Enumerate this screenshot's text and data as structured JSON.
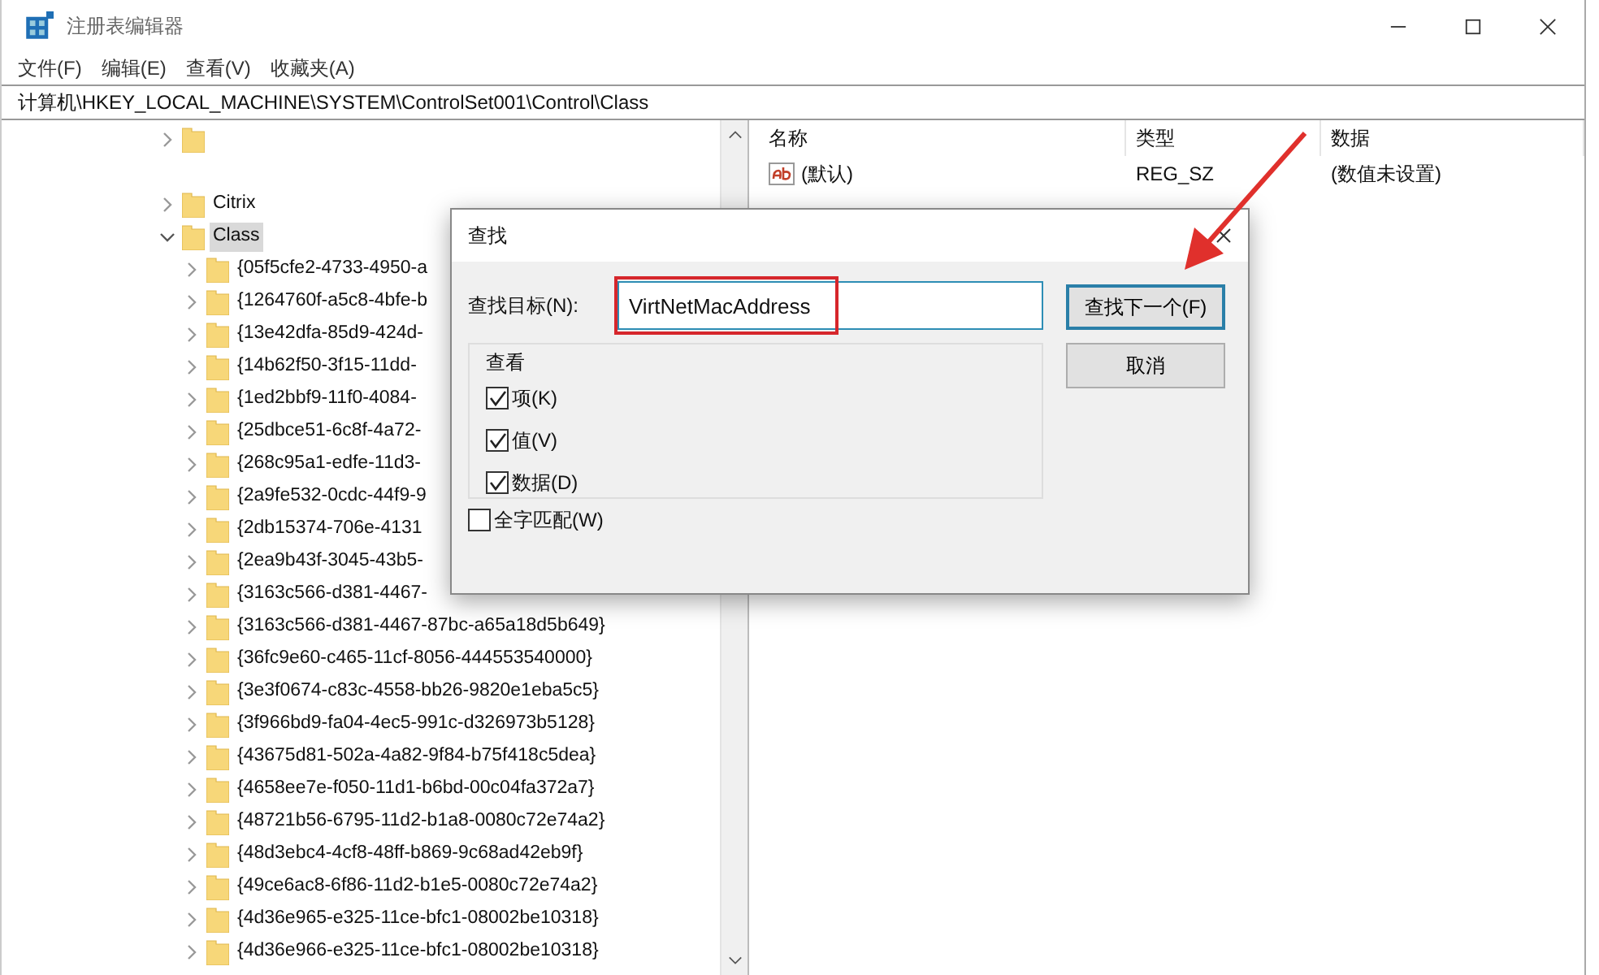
{
  "window": {
    "title": "注册表编辑器"
  },
  "menu": [
    "文件(F)",
    "编辑(E)",
    "查看(V)",
    "收藏夹(A)"
  ],
  "address": "计算机\\HKEY_LOCAL_MACHINE\\SYSTEM\\ControlSet001\\Control\\Class",
  "tree": [
    {
      "kind": "obscured",
      "expanded": false
    },
    {
      "kind": "blank"
    },
    {
      "kind": "folder",
      "label": "Citrix",
      "expanded": false,
      "selected": false
    },
    {
      "kind": "folder",
      "label": "Class",
      "expanded": true,
      "selected": true,
      "children": [
        {
          "label": "{05f5cfe2-4733-4950-a"
        },
        {
          "label": "{1264760f-a5c8-4bfe-b"
        },
        {
          "label": "{13e42dfa-85d9-424d-"
        },
        {
          "label": "{14b62f50-3f15-11dd-"
        },
        {
          "label": "{1ed2bbf9-11f0-4084-"
        },
        {
          "label": "{25dbce51-6c8f-4a72-"
        },
        {
          "label": "{268c95a1-edfe-11d3-"
        },
        {
          "label": "{2a9fe532-0cdc-44f9-9"
        },
        {
          "label": "{2db15374-706e-4131"
        },
        {
          "label": "{2ea9b43f-3045-43b5-"
        },
        {
          "label": "{3163c566-d381-4467-"
        },
        {
          "label": "{3163c566-d381-4467-87bc-a65a18d5b649}"
        },
        {
          "label": "{36fc9e60-c465-11cf-8056-444553540000}"
        },
        {
          "label": "{3e3f0674-c83c-4558-bb26-9820e1eba5c5}"
        },
        {
          "label": "{3f966bd9-fa04-4ec5-991c-d326973b5128}"
        },
        {
          "label": "{43675d81-502a-4a82-9f84-b75f418c5dea}"
        },
        {
          "label": "{4658ee7e-f050-11d1-b6bd-00c04fa372a7}"
        },
        {
          "label": "{48721b56-6795-11d2-b1a8-0080c72e74a2}"
        },
        {
          "label": "{48d3ebc4-4cf8-48ff-b869-9c68ad42eb9f}"
        },
        {
          "label": "{49ce6ac8-6f86-11d2-b1e5-0080c72e74a2}"
        },
        {
          "label": "{4d36e965-e325-11ce-bfc1-08002be10318}"
        },
        {
          "label": "{4d36e966-e325-11ce-bfc1-08002be10318}"
        }
      ]
    }
  ],
  "values": {
    "columns": [
      "名称",
      "类型",
      "数据"
    ],
    "rows": [
      {
        "name": "(默认)",
        "type": "REG_SZ",
        "data": "(数值未设置)"
      }
    ]
  },
  "find_dialog": {
    "title": "查找",
    "target_label": "查找目标(N):",
    "target_value": "VirtNetMacAddress",
    "look_in_label": "查看",
    "options": [
      {
        "label": "项(K)",
        "checked": true
      },
      {
        "label": "值(V)",
        "checked": true
      },
      {
        "label": "数据(D)",
        "checked": true
      }
    ],
    "whole_match": {
      "label": "全字匹配(W)",
      "checked": false
    },
    "buttons": [
      {
        "label": "查找下一个(F)",
        "default": true
      },
      {
        "label": "取消",
        "default": false
      }
    ]
  }
}
